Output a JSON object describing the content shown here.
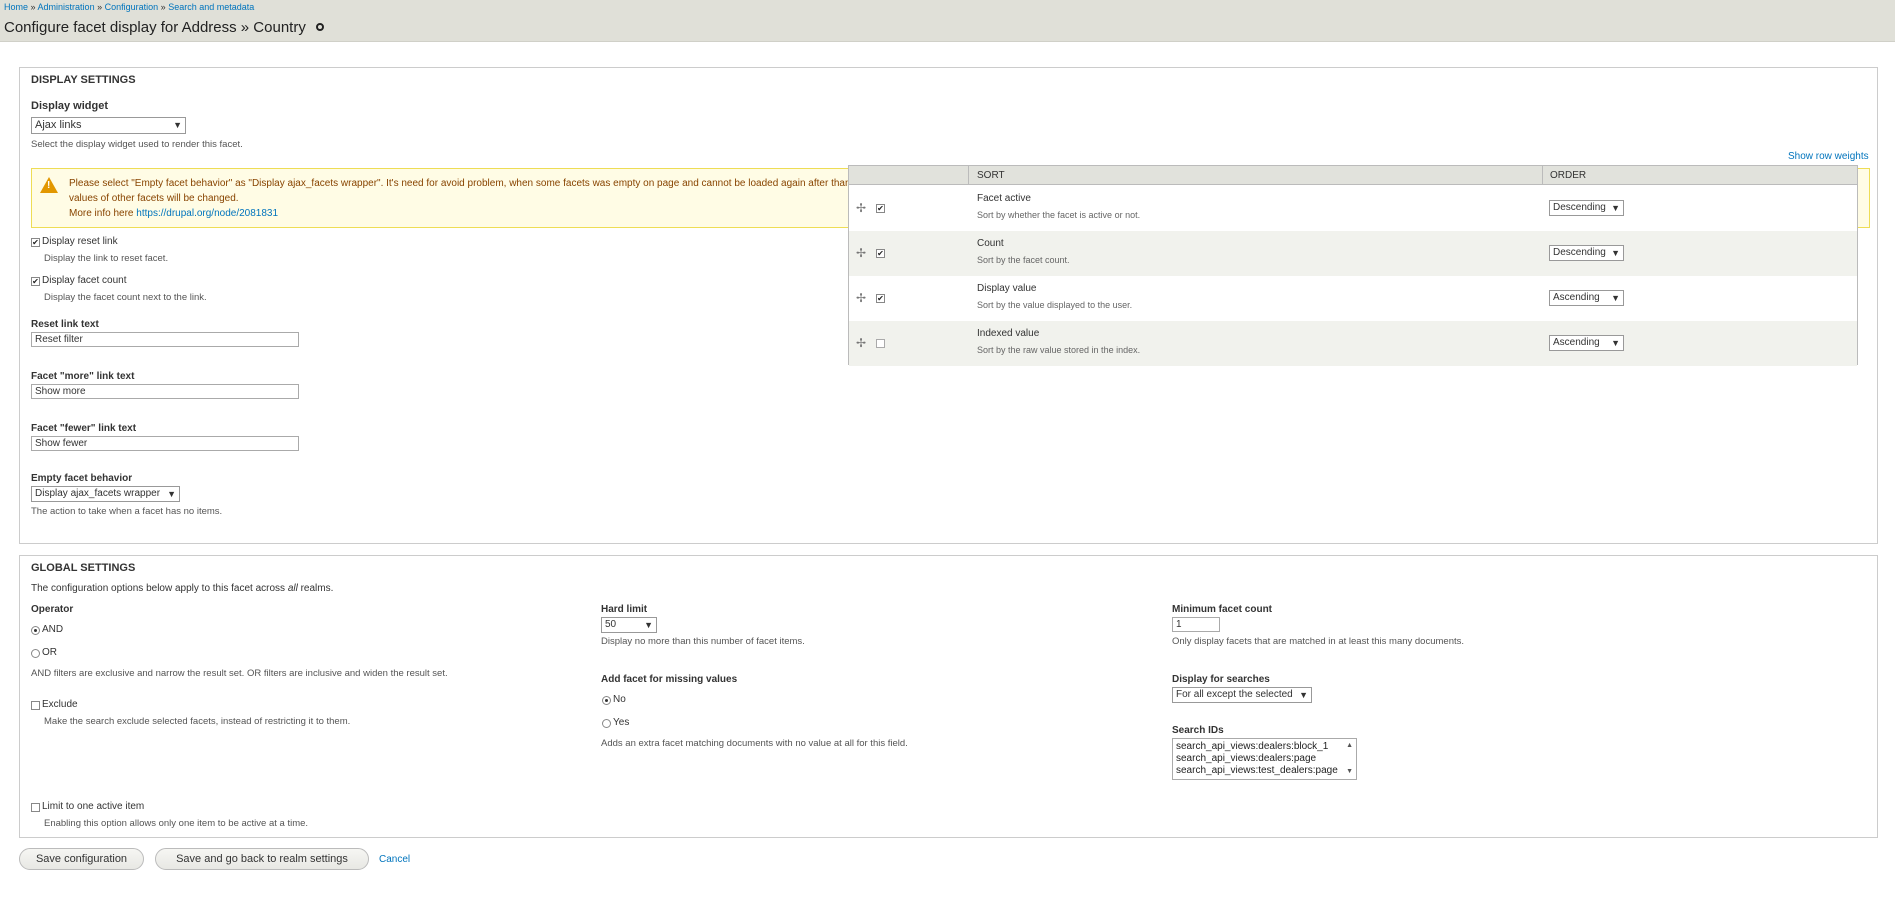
{
  "breadcrumb": {
    "items": [
      "Home",
      "Administration",
      "Configuration",
      "Search and metadata"
    ],
    "separator": "»"
  },
  "page_title": "Configure facet display for Address » Country",
  "display_settings": {
    "legend": "Display settings",
    "widget_label": "Display widget",
    "widget_value": "Ajax links",
    "widget_desc": "Select the display widget used to render this facet.",
    "warning_line1": "Please select \"Empty facet behavior\" as \"Display ajax_facets wrapper\". It's need for avoid problem, when some facets was empty on page and cannot be loaded again after than",
    "warning_line2": "values of other facets will be changed.",
    "warning_more": "More info here",
    "warning_link": "https://drupal.org/node/2081831",
    "reset_link_label": "Display reset link",
    "reset_link_desc": "Display the link to reset facet.",
    "facet_count_label": "Display facet count",
    "facet_count_desc": "Display the facet count next to the link.",
    "reset_text_label": "Reset link text",
    "reset_text_value": "Reset filter",
    "more_text_label": "Facet \"more\" link text",
    "more_text_value": "Show more",
    "fewer_text_label": "Facet \"fewer\" link text",
    "fewer_text_value": "Show fewer",
    "empty_label": "Empty facet behavior",
    "empty_value": "Display ajax_facets wrapper",
    "empty_desc": "The action to take when a facet has no items."
  },
  "sort_table": {
    "show_weights": "Show row weights",
    "headers": [
      "Sort",
      "Order"
    ],
    "rows": [
      {
        "title": "Facet active",
        "desc": "Sort by whether the facet is active or not.",
        "checked": true,
        "order": "Descending"
      },
      {
        "title": "Count",
        "desc": "Sort by the facet count.",
        "checked": true,
        "order": "Descending"
      },
      {
        "title": "Display value",
        "desc": "Sort by the value displayed to the user.",
        "checked": true,
        "order": "Ascending"
      },
      {
        "title": "Indexed value",
        "desc": "Sort by the raw value stored in the index.",
        "checked": false,
        "order": "Ascending"
      }
    ]
  },
  "global_settings": {
    "legend": "Global settings",
    "intro_before": "The configuration options below apply to this facet across ",
    "intro_em": "all",
    "intro_after": " realms.",
    "operator_label": "Operator",
    "op_and": "AND",
    "op_or": "OR",
    "op_desc": "AND filters are exclusive and narrow the result set. OR filters are inclusive and widen the result set.",
    "exclude_label": "Exclude",
    "exclude_desc": "Make the search exclude selected facets, instead of restricting it to them.",
    "limit_label": "Limit to one active item",
    "limit_desc": "Enabling this option allows only one item to be active at a time.",
    "hard_limit_label": "Hard limit",
    "hard_limit_value": "50",
    "hard_limit_desc": "Display no more than this number of facet items.",
    "missing_label": "Add facet for missing values",
    "missing_no": "No",
    "missing_yes": "Yes",
    "missing_desc": "Adds an extra facet matching documents with no value at all for this field.",
    "min_count_label": "Minimum facet count",
    "min_count_value": "1",
    "min_count_desc": "Only display facets that are matched in at least this many documents.",
    "display_searches_label": "Display for searches",
    "display_searches_value": "For all except the selected",
    "search_ids_label": "Search IDs",
    "search_ids": [
      "search_api_views:dealers:block_1",
      "search_api_views:dealers:page",
      "search_api_views:test_dealers:page"
    ]
  },
  "actions": {
    "save": "Save configuration",
    "save_back": "Save and go back to realm settings",
    "cancel": "Cancel"
  },
  "glyphs": {
    "drag": "✢",
    "check": "✔",
    "caret": "▼",
    "up": "▲",
    "down": "▼",
    "warn": "!"
  }
}
